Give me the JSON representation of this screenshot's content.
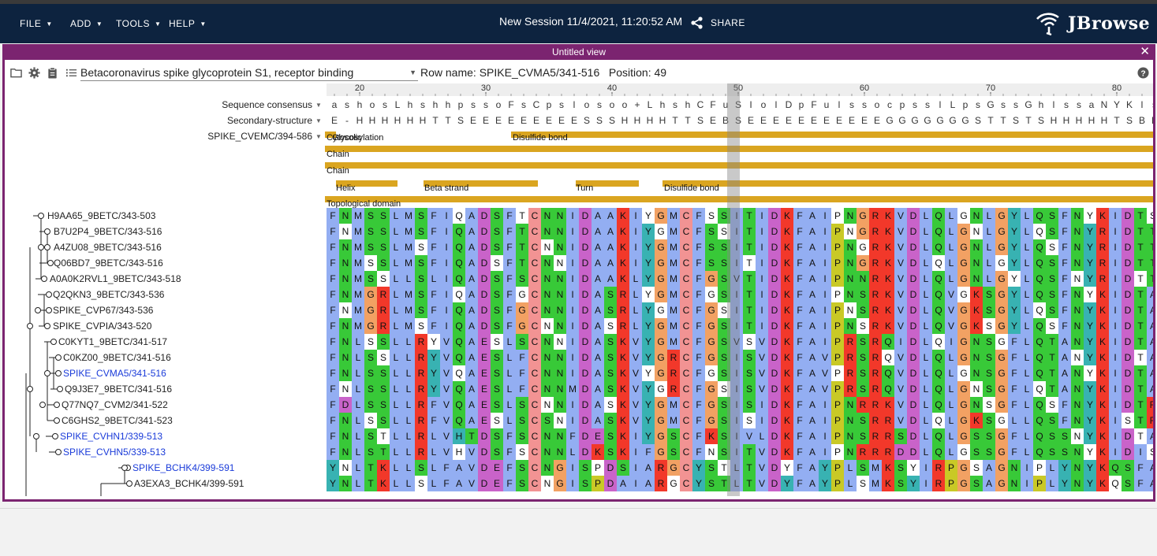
{
  "appbar": {
    "menus": [
      {
        "label": "FILE"
      },
      {
        "label": "ADD"
      },
      {
        "label": "TOOLS"
      },
      {
        "label": "HELP"
      }
    ],
    "session_title": "New Session 11/4/2021, 11:20:52 AM",
    "share_label": "SHARE",
    "brand": "JBrowse"
  },
  "view": {
    "title": "Untitled view",
    "track_name": "Betacoronavirus spike glycoprotein S1, receptor binding",
    "row_info": "Row name: SPIKE_CVMA5/341-516   Position: 49",
    "ruler_ticks": [
      "20",
      "30",
      "40",
      "50",
      "60",
      "70",
      "80"
    ],
    "header_rows": [
      {
        "label": "Sequence consensus",
        "seq": "ashosLhshhpssoFsCpslosoo+LhshCFuSIolDpFulssocpsslLpsGssGhlssaNYKlsss"
      },
      {
        "label": "Secondary-structure",
        "seq": "E-HHHHHHTTSEEEEEEEEESSSHHHHTTSEBSEEEEEEEEEEEGGGGGGGSTTSTSHHHHHTSBB-SS"
      },
      {
        "label": "SPIKE_CVEMC/394-586",
        "seq": ""
      }
    ],
    "features": [
      "Cytosolic",
      "Glycosylation",
      "Disulfide bond",
      "Chain",
      "Chain",
      "Helix",
      "Beta strand",
      "Turn",
      "Disulfide bond",
      "Topological domain"
    ],
    "sequences": [
      {
        "name": "H9AA65_9BETC/343-503",
        "seq": "FNMSSLMSFIQADSFTCNNIDAAKIYGMCFSSITIDKFAIPNGRKVDLQLGNLGYLQSFNYKIDTS"
      },
      {
        "name": "B7U2P4_9BETC/343-516",
        "seq": "FNMSSLMSFIQADSFTCNNIDAAKIYGMCFSSITIDKFAIPNGRKVDLQLGNLGYLQSFNYRIDTT"
      },
      {
        "name": "A4ZU08_9BETC/343-516",
        "seq": "FNMSSLMSFIQADSFTCNNIDAAKIYGMCFSSITIDKFAIPNGRKVDLQLGNLGYLQSFNYRIDTT"
      },
      {
        "name": "Q06BD7_9BETC/343-516",
        "seq": "FNMSSLMSFIQADSFTCNNIDAAKIYGMCFSSITIDKFAIPNGRKVDLQLGNLGYLQSFNYRIDTT"
      },
      {
        "name": "A0A0K2RVL1_9BETC/343-518",
        "seq": "FNMSSLLSLIQADSFSCNNIDAAKLYGMCFGSVTIDKFAIPNNRKVDLQLGNLGYLQSFNYRIDTT"
      },
      {
        "name": "Q2QKN3_9BETC/343-536",
        "seq": "FNMGRLMSFIQADSFGCNNIDASRLYGMCFGSITIDKFAIPNSRKVDLQVGKSGYLQSFNYKIDTA"
      },
      {
        "name": "SPIKE_CVP67/343-536",
        "seq": "FNMGRLMSFIQADSFGCNNIDASRLYGMCFGSITIDKFAIPNSRKVDLQVGKSGYLQSFNYKIDTA"
      },
      {
        "name": "SPIKE_CVPIA/343-520",
        "seq": "FNMGRLMSFIQADSFGCNNIDASRLYGMCFGSITIDKFAIPNSRKVDLQVGKSGYLQSFNYKIDTA"
      },
      {
        "name": "C0KYT1_9BETC/341-517",
        "seq": "FNLSSLLRYVQAESLSCNNIDASKVYGMCFGSVSVDKFAIPRSRQIDLQIGNSGFLQTANYKIDTA"
      },
      {
        "name": "C0KZ00_9BETC/341-516",
        "seq": "FNLSSLLRYVQAESLFCNNIDASKVYGRCFGSISVDKFAVPRSRQVDLQLGNSGFLQTANYKIDTA"
      },
      {
        "name": "SPIKE_CVMA5/341-516",
        "seq": "FNLSSLLRYVQAESLFCNNIDASKVYGRCFGSISVDKFAVPRSRQVDLQLGNSGFLQTANYKIDTA"
      },
      {
        "name": "Q9J3E7_9BETC/341-516",
        "seq": "FNLSSLLRYVQAESLFCNNMDASKVYGRCFGSISVDKFAVPRSRQVDLQLGNSGFLQTANYKIDTA"
      },
      {
        "name": "Q77NQ7_CVM2/341-522",
        "seq": "FDLSSLLRFVQAESLSCNNIDASKVYGMCFGSISIDKFAIPNRRKVDLQLGNSGFLQSFNYKIDTR"
      },
      {
        "name": "C6GHS2_9BETC/341-523",
        "seq": "FNLSSLLRFVQAESLSCSNIDASKVYGMCFGSISIDKFAIPNSRRVDLQLGKSGLLQSFNYKISTR"
      },
      {
        "name": "SPIKE_CVHN1/339-513",
        "seq": "FNLSTLLRLVHTDSFSCNNFDESKIYGSCFKSIVLDKFAIPNSRRSDLQLGSSGFLQSSNYKIDTA"
      },
      {
        "name": "SPIKE_CVHN5/339-513",
        "seq": "FNLSTLLRLVHVDSFSCNNLDKSKIFGSCFNSITVDKFAIPNRRRDDLQLGSSGFLQSSNYKIDIS"
      },
      {
        "name": "SPIKE_BCHK4/399-591",
        "seq": "YNLTKLLSLFAVDEFSCNGISPDSIARGCYSTLTVDYFAYPLSMKSYIRPGSAGNIPLYNYKQSFA"
      },
      {
        "name": "A3EXA3_BCHK4/399-591",
        "seq": "YNLTKLLSLFAVDEFSCNGISPDAIARGCYSTLTVDYFAYPLSMKSYIRPGSAGNIPLYNYKQSFA"
      }
    ]
  },
  "colors": {
    "appbar": "#0d233f",
    "view_border": "#7b2470",
    "feature_bar": "#daa520",
    "link_name": "#1a3bd9",
    "highlight_column": "#888888"
  }
}
